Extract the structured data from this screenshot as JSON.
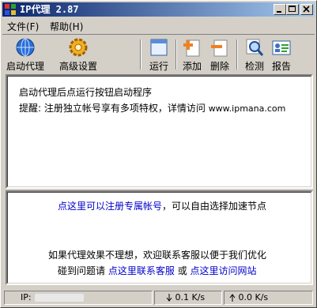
{
  "title": "IP代理 2.87",
  "menu": [
    "文件(F)",
    "帮助(H)"
  ],
  "toolbar": {
    "start_proxy": "启动代理",
    "advanced": "高级设置",
    "run": "运行",
    "add": "添加",
    "remove": "删除",
    "check": "检测",
    "report": "报告"
  },
  "top_panel": {
    "line1": "启动代理后点运行按钮启动程序",
    "line2_prefix": "提醒: 注册独立帐号享有多项特权，详情访问 ",
    "line2_url": "www.ipmana.com"
  },
  "bottom_panel": {
    "link_register": "点这里可以注册专属帐号",
    "register_suffix": "，可以自由选择加速节点",
    "feedback": "如果代理效果不理想，欢迎联系客服以便于我们优化",
    "issue_prefix": "碰到问题请",
    "link_contact": "点这里联系客服",
    "or_text": "或",
    "link_site": "点这里访问网站"
  },
  "status": {
    "ip_label": "IP:",
    "down_icon": "down-arrow-icon",
    "down_speed": "0.1 K/s",
    "up_icon": "up-arrow-icon",
    "up_speed": "0.0 K/s"
  }
}
